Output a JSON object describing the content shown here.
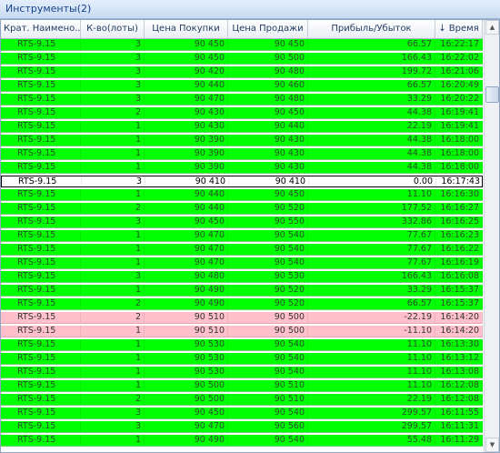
{
  "window": {
    "title": "Инструменты(2)"
  },
  "table": {
    "columns": [
      "Крат. Наимено..",
      "К-во(лоты)",
      "Цена Покупки",
      "Цена Продажи",
      "Прибыль/Убыток",
      "Время"
    ],
    "sorted_column": "Время",
    "rows": [
      {
        "name": "RTS-9.15",
        "qty": "3",
        "buy": "90 450",
        "sell": "90 450",
        "pnl": "66.57",
        "time": "16:22:17",
        "status": "green"
      },
      {
        "name": "RTS-9.15",
        "qty": "3",
        "buy": "90 450",
        "sell": "90 500",
        "pnl": "166.43",
        "time": "16:22:02",
        "status": "green"
      },
      {
        "name": "RTS-9.15",
        "qty": "3",
        "buy": "90 420",
        "sell": "90 480",
        "pnl": "199.72",
        "time": "16:21:06",
        "status": "green"
      },
      {
        "name": "RTS-9.15",
        "qty": "3",
        "buy": "90 440",
        "sell": "90 460",
        "pnl": "66.57",
        "time": "16:20:49",
        "status": "green"
      },
      {
        "name": "RTS-9.15",
        "qty": "3",
        "buy": "90 470",
        "sell": "90 480",
        "pnl": "33.29",
        "time": "16:20:22",
        "status": "green"
      },
      {
        "name": "RTS-9.15",
        "qty": "2",
        "buy": "90 430",
        "sell": "90 450",
        "pnl": "44.38",
        "time": "16:19:41",
        "status": "green"
      },
      {
        "name": "RTS-9.15",
        "qty": "1",
        "buy": "90 430",
        "sell": "90 440",
        "pnl": "22.19",
        "time": "16:19:41",
        "status": "green"
      },
      {
        "name": "RTS-9.15",
        "qty": "1",
        "buy": "90 390",
        "sell": "90 430",
        "pnl": "44.38",
        "time": "16:18:00",
        "status": "green"
      },
      {
        "name": "RTS-9.15",
        "qty": "1",
        "buy": "90 390",
        "sell": "90 430",
        "pnl": "44.38",
        "time": "16:18:00",
        "status": "green"
      },
      {
        "name": "RTS-9.15",
        "qty": "1",
        "buy": "90 390",
        "sell": "90 430",
        "pnl": "44.38",
        "time": "16:18:00",
        "status": "green"
      },
      {
        "name": "RTS-9.15",
        "qty": "3",
        "buy": "90 410",
        "sell": "90 410",
        "pnl": "0.00",
        "time": "16:17:43",
        "status": "selected"
      },
      {
        "name": "RTS-9.15",
        "qty": "1",
        "buy": "90 440",
        "sell": "90 450",
        "pnl": "11.10",
        "time": "16:16:30",
        "status": "green"
      },
      {
        "name": "RTS-9.15",
        "qty": "2",
        "buy": "90 440",
        "sell": "90 520",
        "pnl": "177.52",
        "time": "16:16:27",
        "status": "green"
      },
      {
        "name": "RTS-9.15",
        "qty": "3",
        "buy": "90 450",
        "sell": "90 550",
        "pnl": "332.86",
        "time": "16:16:25",
        "status": "green"
      },
      {
        "name": "RTS-9.15",
        "qty": "1",
        "buy": "90 470",
        "sell": "90 540",
        "pnl": "77.67",
        "time": "16:16:23",
        "status": "green"
      },
      {
        "name": "RTS-9.15",
        "qty": "1",
        "buy": "90 470",
        "sell": "90 540",
        "pnl": "77.67",
        "time": "16:16:22",
        "status": "green"
      },
      {
        "name": "RTS-9.15",
        "qty": "1",
        "buy": "90 470",
        "sell": "90 540",
        "pnl": "77.67",
        "time": "16:16:19",
        "status": "green"
      },
      {
        "name": "RTS-9.15",
        "qty": "3",
        "buy": "90 480",
        "sell": "90 530",
        "pnl": "166.43",
        "time": "16:16:08",
        "status": "green"
      },
      {
        "name": "RTS-9.15",
        "qty": "1",
        "buy": "90 490",
        "sell": "90 520",
        "pnl": "33.29",
        "time": "16:15:37",
        "status": "green"
      },
      {
        "name": "RTS-9.15",
        "qty": "2",
        "buy": "90 490",
        "sell": "90 520",
        "pnl": "66.57",
        "time": "16:15:37",
        "status": "green"
      },
      {
        "name": "RTS-9.15",
        "qty": "2",
        "buy": "90 510",
        "sell": "90 500",
        "pnl": "-22.19",
        "time": "16:14:20",
        "status": "pink"
      },
      {
        "name": "RTS-9.15",
        "qty": "1",
        "buy": "90 510",
        "sell": "90 500",
        "pnl": "-11.10",
        "time": "16:14:20",
        "status": "pink"
      },
      {
        "name": "RTS-9.15",
        "qty": "1",
        "buy": "90 530",
        "sell": "90 540",
        "pnl": "11.10",
        "time": "16:13:30",
        "status": "green"
      },
      {
        "name": "RTS-9.15",
        "qty": "1",
        "buy": "90 530",
        "sell": "90 540",
        "pnl": "11.10",
        "time": "16:13:12",
        "status": "green"
      },
      {
        "name": "RTS-9.15",
        "qty": "1",
        "buy": "90 530",
        "sell": "90 540",
        "pnl": "11.10",
        "time": "16:13:08",
        "status": "green"
      },
      {
        "name": "RTS-9.15",
        "qty": "1",
        "buy": "90 500",
        "sell": "90 510",
        "pnl": "11.10",
        "time": "16:12:08",
        "status": "green"
      },
      {
        "name": "RTS-9.15",
        "qty": "2",
        "buy": "90 500",
        "sell": "90 510",
        "pnl": "22.19",
        "time": "16:12:08",
        "status": "green"
      },
      {
        "name": "RTS-9.15",
        "qty": "3",
        "buy": "90 450",
        "sell": "90 540",
        "pnl": "299.57",
        "time": "16:11:55",
        "status": "green"
      },
      {
        "name": "RTS-9.15",
        "qty": "3",
        "buy": "90 470",
        "sell": "90 560",
        "pnl": "299.57",
        "time": "16:11:31",
        "status": "green"
      },
      {
        "name": "RTS-9.15",
        "qty": "1",
        "buy": "90 490",
        "sell": "90 540",
        "pnl": "55.48",
        "time": "16:11:29",
        "status": "green"
      }
    ]
  },
  "icons": {
    "sort": "arrow-down-icon",
    "scroll_up": "scroll-up-icon",
    "scroll_down": "scroll-down-icon"
  },
  "colors": {
    "profit_row": "#00ff00",
    "loss_row": "#ffc0cb",
    "selected_row": "#ffffff",
    "title_text": "#15428b"
  }
}
